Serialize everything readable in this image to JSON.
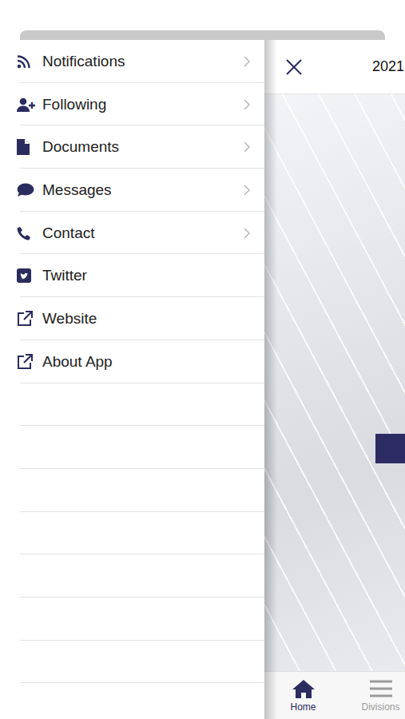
{
  "drawer": {
    "items": [
      {
        "label": "Notifications",
        "chevron": true
      },
      {
        "label": "Following",
        "chevron": true
      },
      {
        "label": "Documents",
        "chevron": true
      },
      {
        "label": "Messages",
        "chevron": true
      },
      {
        "label": "Contact",
        "chevron": true
      },
      {
        "label": "Twitter",
        "chevron": false
      },
      {
        "label": "Website",
        "chevron": false
      },
      {
        "label": "About App",
        "chevron": false
      }
    ]
  },
  "main": {
    "title": "2021",
    "tabs": [
      {
        "label": "Home",
        "selected": true
      },
      {
        "label": "Divisions",
        "selected": false
      }
    ]
  }
}
